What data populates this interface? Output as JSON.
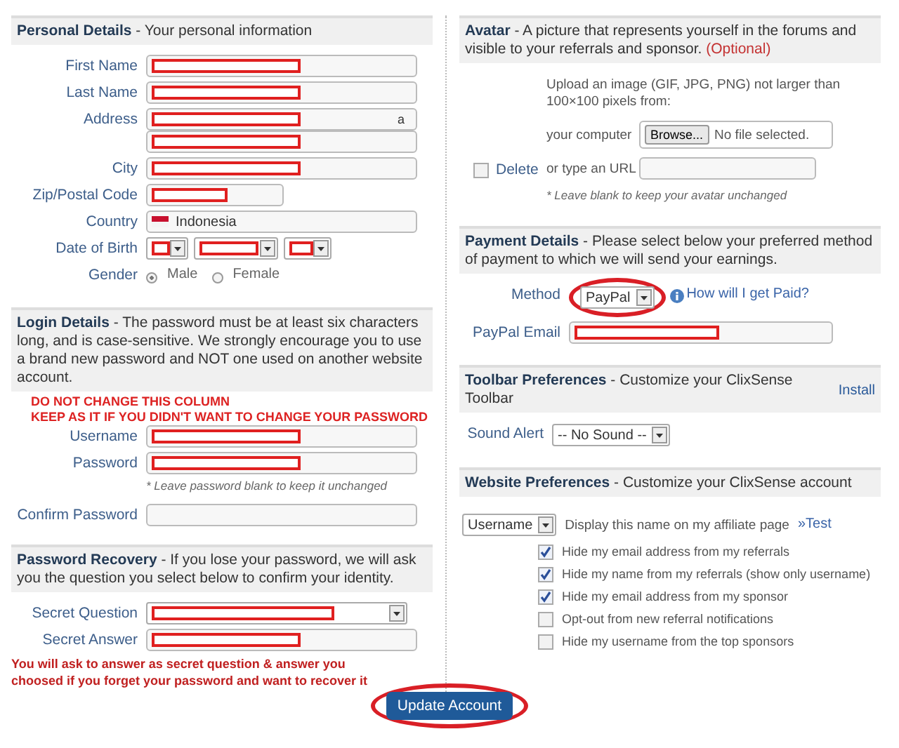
{
  "personal": {
    "heading": "**Personal Details** - Your personal information",
    "fields": [
      {
        "label": "First Name",
        "kind": "text",
        "redacted": true
      },
      {
        "label": "Last Name",
        "kind": "text",
        "redacted": true
      },
      {
        "label": "Address",
        "kind": "address",
        "lines": [
          {
            "redacted": true,
            "value": "a"
          },
          {
            "redacted": true
          }
        ]
      },
      {
        "label": "City",
        "kind": "text",
        "redacted": true
      },
      {
        "label": "Zip/Postal Code",
        "kind": "shorttext",
        "redacted": true
      },
      {
        "label": "Country",
        "kind": "country",
        "value": "Indonesia"
      },
      {
        "label": "Date of Birth",
        "kind": "dob",
        "parts": [
          {
            "redacted": true
          },
          {
            "redacted": true
          },
          {
            "redacted": true
          }
        ]
      },
      {
        "label": "Gender",
        "kind": "gender",
        "options": [
          {
            "label": "Male",
            "selected": true
          },
          {
            "label": "Female",
            "selected": false
          }
        ]
      }
    ]
  },
  "login": {
    "heading": "**Login Details** - The password must be at least six characters long, and is case-sensitive. We strongly encourage you to use a brand new password and NOT one used on another website account.",
    "annotations": [
      "DO NOT CHANGE THIS COLUMN",
      "KEEP AS IT IF YOU DIDN'T WANT TO CHANGE YOUR PASSWORD"
    ],
    "fields": [
      {
        "label": "Username",
        "kind": "text",
        "redacted": true
      },
      {
        "label": "Password",
        "kind": "text",
        "redacted": true
      },
      {
        "kind": "hint",
        "text": "* Leave password blank to keep it unchanged"
      },
      {
        "label": "Confirm Password",
        "kind": "text"
      }
    ]
  },
  "recovery": {
    "heading": "**Password Recovery** - If you lose your password, we will ask you the question you select below to confirm your identity.",
    "fields": [
      {
        "label": "Secret Question",
        "kind": "select",
        "redacted": true
      },
      {
        "label": "Secret Answer",
        "kind": "text",
        "redacted": true
      }
    ],
    "note": [
      "You will ask to answer as secret question & answer you",
      "choosed if you forget your password and want to recover it"
    ]
  },
  "avatar": {
    "heading": "**Avatar** - A picture that represents yourself in the forums and visible to your referrals and sponsor.",
    "optional": "(Optional)",
    "delete": {
      "label": "Delete",
      "checked": false
    },
    "intro": "Upload an image (GIF, JPG, PNG) not larger than 100×100 pixels from:",
    "computer_label": "your computer",
    "browse": "Browse...",
    "file_status": "No file selected.",
    "url_label": "or type an URL",
    "hint": "* Leave blank to keep your avatar unchanged"
  },
  "payment": {
    "heading": "**Payment Details** - Please select below your preferred method of payment to which we will send your earnings.",
    "method_label": "Method",
    "method": "PayPal",
    "help_link": "How will I get Paid?",
    "email_label": "PayPal Email",
    "email_redacted": true
  },
  "toolbar": {
    "heading": "**Toolbar Preferences** - Customize your ClixSense Toolbar",
    "install": "Install",
    "sound_label": "Sound Alert",
    "sound": "-- No Sound --"
  },
  "website": {
    "heading": "**Website Preferences** - Customize your ClixSense account",
    "display_select": "Username",
    "display_text": "Display this name on my affiliate page",
    "test_link": "»Test",
    "options": [
      {
        "label": "Hide my email address from my referrals",
        "checked": true
      },
      {
        "label": "Hide my name from my referrals (show only username)",
        "checked": true
      },
      {
        "label": "Hide my email address from my sponsor",
        "checked": true
      },
      {
        "label": "Opt-out from new referral notifications",
        "checked": false
      },
      {
        "label": "Hide my username from the top sponsors",
        "checked": false
      }
    ]
  },
  "submit": {
    "label": "Update Account",
    "circled": true
  }
}
